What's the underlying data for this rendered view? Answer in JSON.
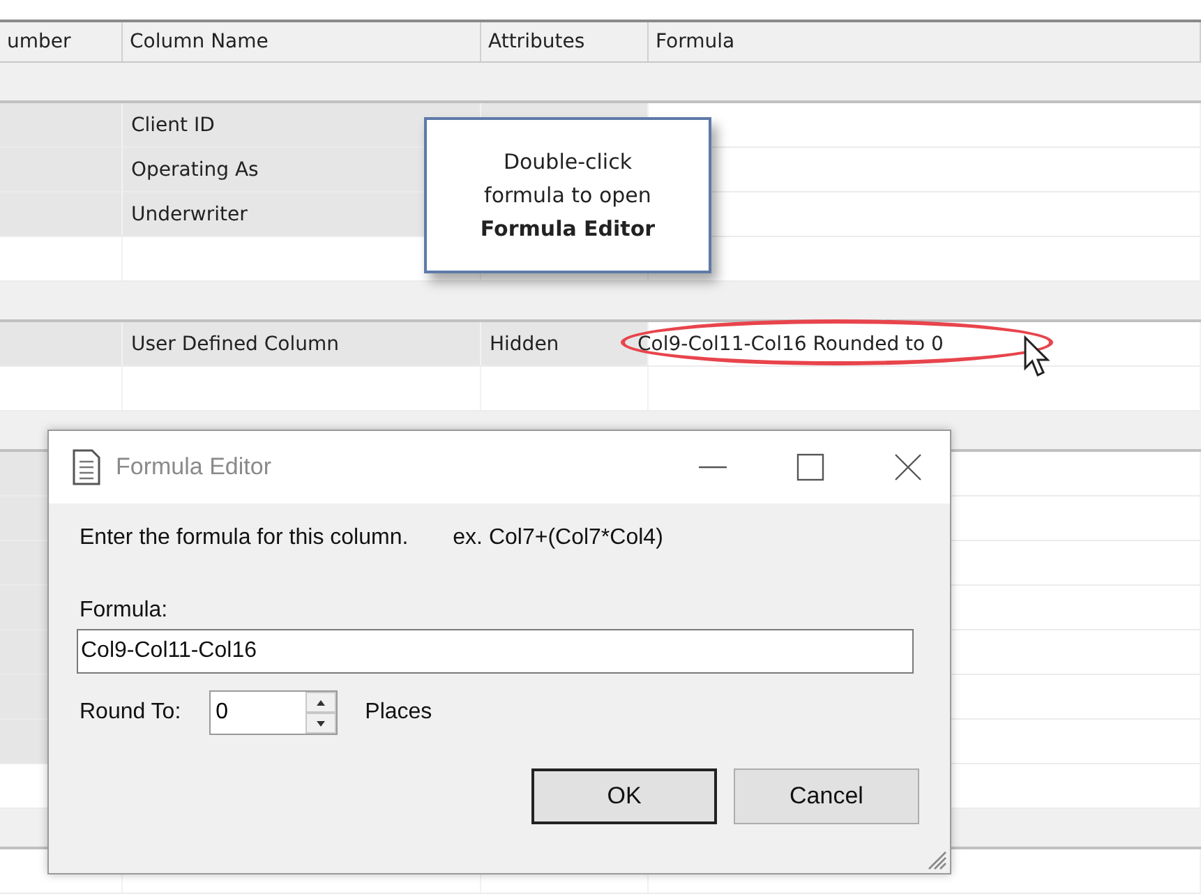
{
  "table": {
    "columns": [
      "umber",
      "Column Name",
      "Attributes",
      "Formula"
    ],
    "rows": [
      {
        "kind": "group"
      },
      {
        "kind": "data",
        "shaded": true,
        "name": "Client ID"
      },
      {
        "kind": "data",
        "shaded": true,
        "name": "Operating As"
      },
      {
        "kind": "data",
        "shaded": true,
        "name": "Underwriter"
      },
      {
        "kind": "data",
        "shaded": false
      },
      {
        "kind": "group"
      },
      {
        "kind": "data",
        "shaded": true,
        "name": "User Defined Column",
        "attributes": "Hidden",
        "formula": "Col9-Col11-Col16 Rounded to 0",
        "highlighted": true
      },
      {
        "kind": "data",
        "shaded": false
      },
      {
        "kind": "group"
      },
      {
        "kind": "data",
        "shaded": true
      },
      {
        "kind": "data",
        "shaded": true
      },
      {
        "kind": "data",
        "shaded": true
      },
      {
        "kind": "data",
        "shaded": true
      },
      {
        "kind": "data",
        "shaded": true
      },
      {
        "kind": "data",
        "shaded": true
      },
      {
        "kind": "data",
        "shaded": true
      },
      {
        "kind": "data",
        "shaded": false
      },
      {
        "kind": "group"
      },
      {
        "kind": "data",
        "shaded": false
      }
    ]
  },
  "callout": {
    "text": "Double-click\nformula to open\n**Formula Editor**"
  },
  "dialog": {
    "title": "Formula Editor",
    "instruction": "Enter the formula for this column.",
    "example": "ex. Col7+(Col7*Col4)",
    "formula_label": "Formula:",
    "formula_value": "Col9-Col11-Col16",
    "round_label": "Round To:",
    "round_value": "0",
    "places_label": "Places",
    "buttons": [
      {
        "label": "OK",
        "default": true
      },
      {
        "label": "Cancel",
        "default": false
      }
    ]
  }
}
